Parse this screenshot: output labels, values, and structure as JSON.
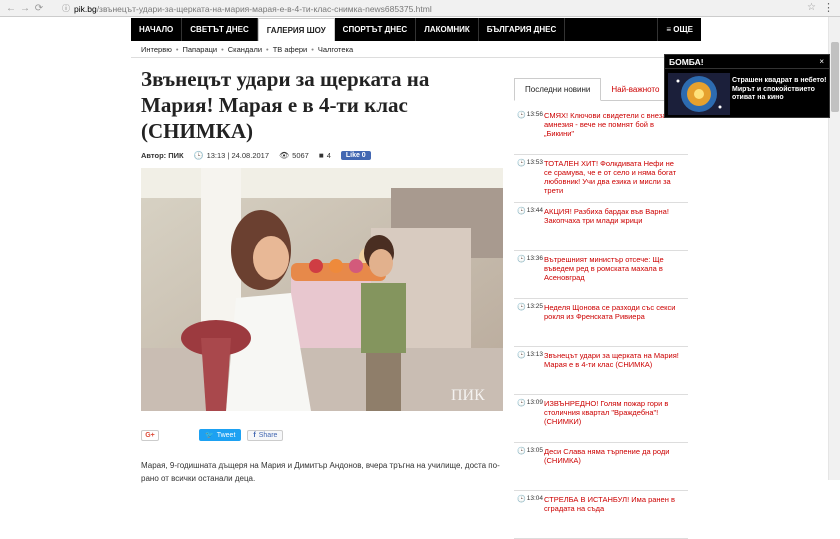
{
  "browser": {
    "host": "pik.bg",
    "path": "/звънецът-удари-за-щерката-на-мария-марая-е-в-4-ти-клас-снимка-news685375.html"
  },
  "topnav": {
    "items": [
      "НАЧАЛО",
      "СВЕТЪТ ДНЕС",
      "ГАЛЕРИЯ ШОУ",
      "СПОРТЪТ ДНЕС",
      "ЛАКОМНИК",
      "БЪЛГАРИЯ ДНЕС"
    ],
    "more": "≡ ОЩЕ"
  },
  "subnav": [
    "Интервю",
    "Папараци",
    "Скандали",
    "ТВ афери",
    "Чалготека"
  ],
  "article": {
    "title": "Звънецът удари за щерката на Мария! Марая е в 4-ти клас (СНИМКА)",
    "author_label": "Автор: ПИК",
    "datetime": "13:13 | 24.08.2017",
    "views": "5067",
    "comments": "4",
    "like_label": "Like 0",
    "watermark": "ПИК",
    "gplus": "G+",
    "tweet_label": "Tweet",
    "share_label": "Share",
    "body": "Марая, 9-годишната дъщеря на Мария и Димитър Андонов, вчера тръгна на училище, доста по-рано от всички останали деца."
  },
  "sidebar": {
    "tabs": [
      "Последни новини",
      "Най-важното"
    ],
    "news": [
      {
        "time": "13:56",
        "text": "СМЯХ! Ключови свидетели с внезапна амнезия - вече не помнят бой в „Бикини\""
      },
      {
        "time": "13:53",
        "text": "ТОТАЛЕН ХИТ! Фолкдивата Нефи не се срамува, че е от село и няма богат любовник! Учи два езика и мисли за трети"
      },
      {
        "time": "13:44",
        "text": "АКЦИЯ! Разбиха бардак във Варна! Закопчаха три млади жрици"
      },
      {
        "time": "13:36",
        "text": "Вътрешният министър отсече: Ще въведем ред в ромската махала в Асеновград"
      },
      {
        "time": "13:25",
        "text": "Неделя Щонова се разходи със секси рокля из Френската Ривиера"
      },
      {
        "time": "13:13",
        "text": "Звънецът удари за щерката на Мария! Марая е в 4-ти клас (СНИМКА)"
      },
      {
        "time": "13:09",
        "text": "ИЗВЪНРЕДНО! Голям пожар гори в столичния квартал \"Враждебна\"! (СНИМКИ)"
      },
      {
        "time": "13:05",
        "text": "Деси Слава няма търпение да роди (СНИМКА)"
      },
      {
        "time": "13:04",
        "text": "СТРЕЛБА В ИСТАНБУЛ! Има ранен в сградата на съда"
      }
    ]
  },
  "popup": {
    "title": "БОМБА!",
    "close": "×",
    "text": "Страшен квадрат в небето! Мирът и спокойствието отиват на кино"
  },
  "colors": {
    "accent": "#cc0000",
    "nav_bg": "#000000",
    "facebook": "#4267b2",
    "twitter": "#1da1f2"
  }
}
